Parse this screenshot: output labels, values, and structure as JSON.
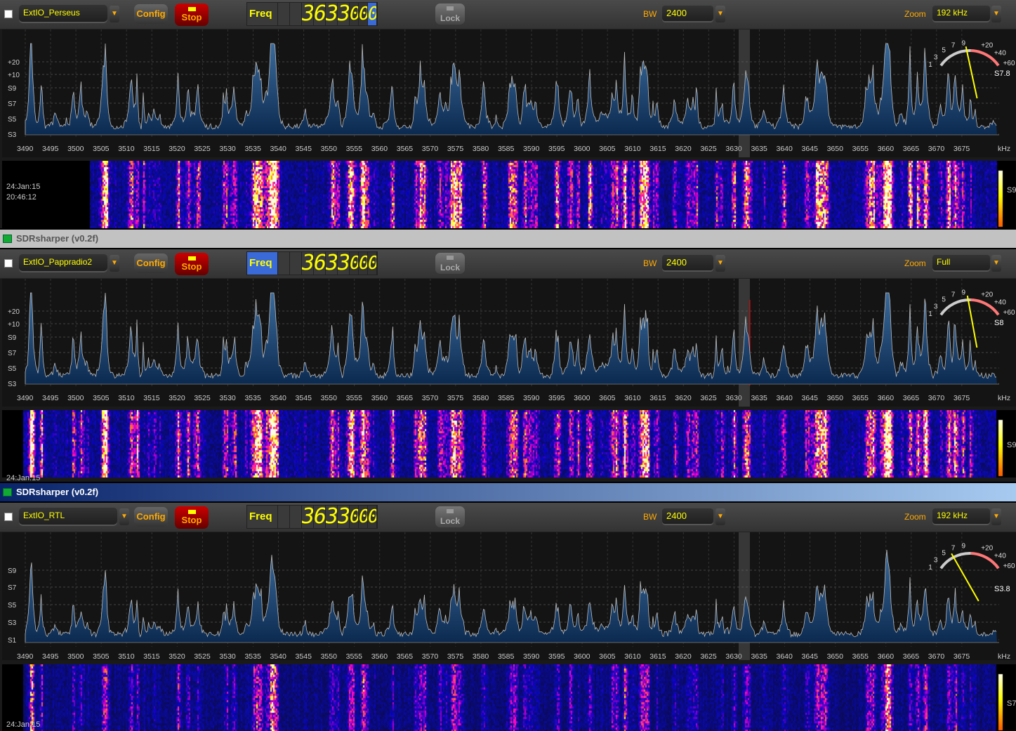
{
  "app": {
    "title": "SDRsharper (v0.2f)"
  },
  "common": {
    "config": "Config",
    "stop": "Stop",
    "lock": "Lock",
    "freq_label": "Freq",
    "bw_label": "BW",
    "zoom_label": "Zoom",
    "khz": "kHz",
    "arrow": "▼"
  },
  "scale": {
    "ticks": [
      "3490",
      "3495",
      "3500",
      "3505",
      "3510",
      "3515",
      "3520",
      "3525",
      "3530",
      "3535",
      "3540",
      "3545",
      "3550",
      "3555",
      "3560",
      "3565",
      "3570",
      "3575",
      "3580",
      "3585",
      "3590",
      "3595",
      "3600",
      "3605",
      "3610",
      "3615",
      "3620",
      "3625",
      "3630",
      "3635",
      "3640",
      "3645",
      "3650",
      "3655",
      "3660",
      "3665",
      "3670",
      "3675"
    ],
    "meter_ticks": [
      "1",
      "3",
      "5",
      "7",
      "9",
      "+20",
      "+40",
      "+60"
    ]
  },
  "panels": [
    {
      "source": "ExtIO_Perseus",
      "digits": [
        "3",
        "6",
        "3",
        "3",
        "0",
        "0",
        "0"
      ],
      "bw": "2400",
      "zoom": "192 kHz",
      "ylabels": [
        "+20",
        "+10",
        "S9",
        "S7",
        "S5",
        "S3"
      ],
      "smeter": "S7.8",
      "needle_level": 0.45,
      "wf_date": "24:Jan:15",
      "wf_time": "20:46:12",
      "wf_scale": "S9",
      "freq_active": false
    },
    {
      "source": "ExtIO_Pappradio2",
      "digits": [
        "3",
        "6",
        "3",
        "3",
        "0",
        "0",
        "0"
      ],
      "bw": "2400",
      "zoom": "Full",
      "ylabels": [
        "+20",
        "+10",
        "S9",
        "S7",
        "S5",
        "S3"
      ],
      "smeter": "S8",
      "needle_level": 0.47,
      "wf_date": "24:Jan:15",
      "wf_time": "",
      "wf_scale": "S9",
      "freq_active": true
    },
    {
      "source": "ExtIO_RTL",
      "digits": [
        "3",
        "6",
        "3",
        "3",
        "0",
        "0",
        "0"
      ],
      "bw": "2400",
      "zoom": "192 kHz",
      "ylabels": [
        "S9",
        "S7",
        "S5",
        "S3",
        "S1"
      ],
      "smeter": "S3.8",
      "needle_level": 0.25,
      "wf_date": "24:Jan:15",
      "wf_time": "",
      "wf_scale": "S7",
      "freq_active": false
    }
  ]
}
